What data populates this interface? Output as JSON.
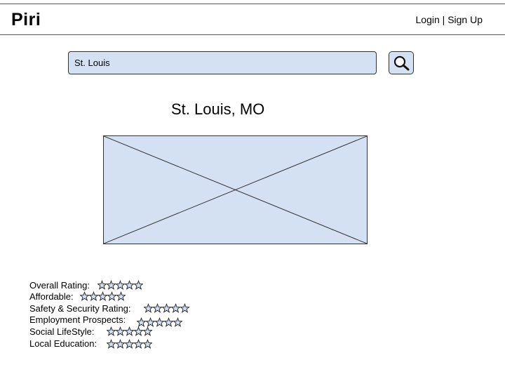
{
  "header": {
    "brand": "Piri",
    "login_label": "Login",
    "separator": "|",
    "signup_label": "Sign Up"
  },
  "search": {
    "value": "St. Louis",
    "icon": "search-icon"
  },
  "city": {
    "title": "St. Louis, MO",
    "image_icon": "image-placeholder"
  },
  "ratings": [
    {
      "label": "Overall Rating:",
      "stars": 0,
      "max": 5
    },
    {
      "label": "Affordable:",
      "stars": 0,
      "max": 5
    },
    {
      "label": "Safety & Security Rating:",
      "stars": 0,
      "max": 5
    },
    {
      "label": "Employment Prospects:",
      "stars": 0,
      "max": 5
    },
    {
      "label": "Social LifeStyle:",
      "stars": 0,
      "max": 5
    },
    {
      "label": "Local Education:",
      "stars": 0,
      "max": 5
    }
  ],
  "colors": {
    "placeholder_fill": "#d4e1f2",
    "star_fill": "#d4e1f2",
    "border": "#333333"
  }
}
